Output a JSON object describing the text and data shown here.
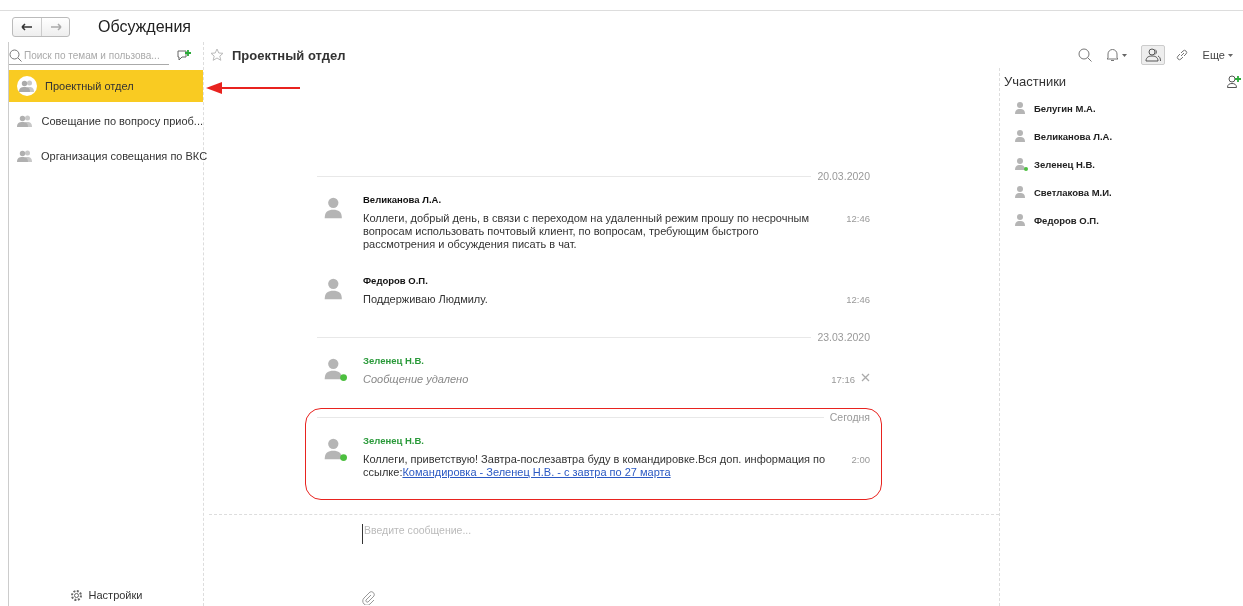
{
  "window": {
    "title": "Обсуждения"
  },
  "sidebar": {
    "search": {
      "placeholder": "Поиск по темам и пользова..."
    },
    "items": [
      {
        "label": "Проектный отдел",
        "selected": true
      },
      {
        "label": "Совещание по вопросу приоб...",
        "selected": false
      },
      {
        "label": "Организация совещания по ВКС",
        "selected": false
      }
    ],
    "settings": "Настройки"
  },
  "chat": {
    "title": "Проектный отдел",
    "toolbar": {
      "participants_pressed": true,
      "more": "Еще"
    },
    "groups": [
      {
        "date": "20.03.2020",
        "highlighted": false,
        "messages": [
          {
            "author": "Великанова Л.А.",
            "online": false,
            "deleted": false,
            "text": "Коллеги, добрый день, в связи с переходом на удаленный режим прошу по несрочным вопросам использовать почтовый клиент, по вопросам, требующим быстрого рассмотрения и обсуждения писать в чат.",
            "time": "12:46"
          },
          {
            "author": "Федоров О.П.",
            "online": false,
            "deleted": false,
            "text": "Поддерживаю Людмилу.",
            "time": "12:46"
          }
        ]
      },
      {
        "date": "23.03.2020",
        "highlighted": false,
        "messages": [
          {
            "author": "Зеленец Н.В.",
            "online": true,
            "deleted": true,
            "text": "Сообщение удалено",
            "time": "17:16"
          }
        ]
      },
      {
        "date": "Сегодня",
        "highlighted": true,
        "messages": [
          {
            "author": "Зеленец Н.В.",
            "online": true,
            "deleted": false,
            "text": "Коллеги, приветствую! Завтра-послезавтра буду в командировке.Вся доп. информация по ссылке:",
            "link": "Командировка - Зеленец Н.В. - с завтра по 27 марта",
            "time": "2:00"
          }
        ]
      }
    ],
    "composer": {
      "placeholder": "Введите сообщение..."
    }
  },
  "participants": {
    "title": "Участники",
    "items": [
      {
        "name": "Белугин М.А.",
        "online": false
      },
      {
        "name": "Великанова Л.А.",
        "online": false
      },
      {
        "name": "Зеленец Н.В.",
        "online": true
      },
      {
        "name": "Светлакова М.И.",
        "online": false
      },
      {
        "name": "Федоров О.П.",
        "online": false
      }
    ]
  }
}
